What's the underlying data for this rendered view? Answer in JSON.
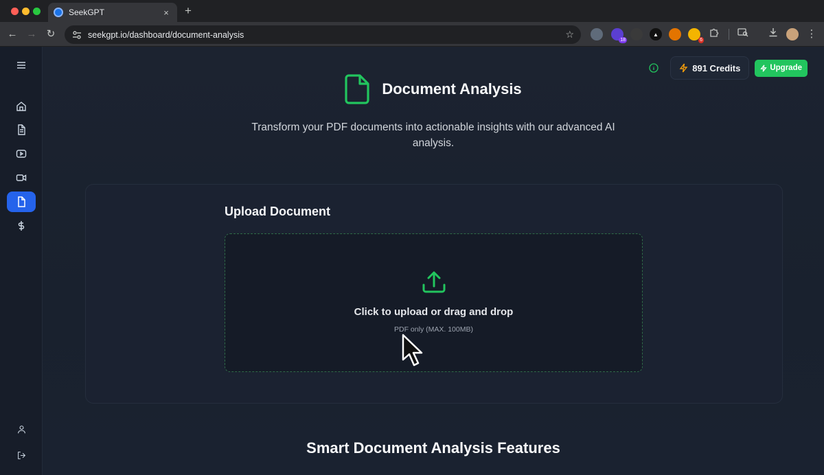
{
  "browser": {
    "tab_title": "SeekGPT",
    "tab_close": "×",
    "new_tab": "+",
    "url": "seekgpt.io/dashboard/document-analysis",
    "extensions": [
      {
        "icon": "extension-icon-1",
        "badge": ""
      },
      {
        "icon": "extension-icon-2",
        "badge": "18"
      },
      {
        "icon": "extension-icon-3",
        "badge": ""
      },
      {
        "icon": "extension-icon-4",
        "badge": ""
      },
      {
        "icon": "extension-icon-5",
        "badge": ""
      },
      {
        "icon": "extension-icon-6",
        "badge": "6"
      }
    ]
  },
  "sidebar": {
    "items": [
      {
        "name": "home",
        "icon": "home-icon",
        "active": false
      },
      {
        "name": "documents",
        "icon": "file-text-icon",
        "active": false
      },
      {
        "name": "youtube",
        "icon": "play-icon",
        "active": false
      },
      {
        "name": "video",
        "icon": "video-icon",
        "active": false
      },
      {
        "name": "document-analysis",
        "icon": "file-icon",
        "active": true
      },
      {
        "name": "pricing",
        "icon": "dollar-icon",
        "active": false
      }
    ],
    "bottom": [
      {
        "name": "profile",
        "icon": "user-icon"
      },
      {
        "name": "logout",
        "icon": "logout-icon"
      }
    ]
  },
  "header": {
    "credits_label": "891 Credits",
    "upgrade_label": "Upgrade"
  },
  "hero": {
    "title": "Document Analysis",
    "subtitle": "Transform your PDF documents into actionable insights with our advanced AI analysis."
  },
  "upload": {
    "heading": "Upload Document",
    "dropzone_text": "Click to upload or drag and drop",
    "dropzone_sub": "PDF only (MAX. 100MB)"
  },
  "features": {
    "title": "Smart Document Analysis Features"
  },
  "colors": {
    "accent_green": "#22c55e",
    "active_blue": "#2563eb",
    "background": "#1c2330"
  }
}
